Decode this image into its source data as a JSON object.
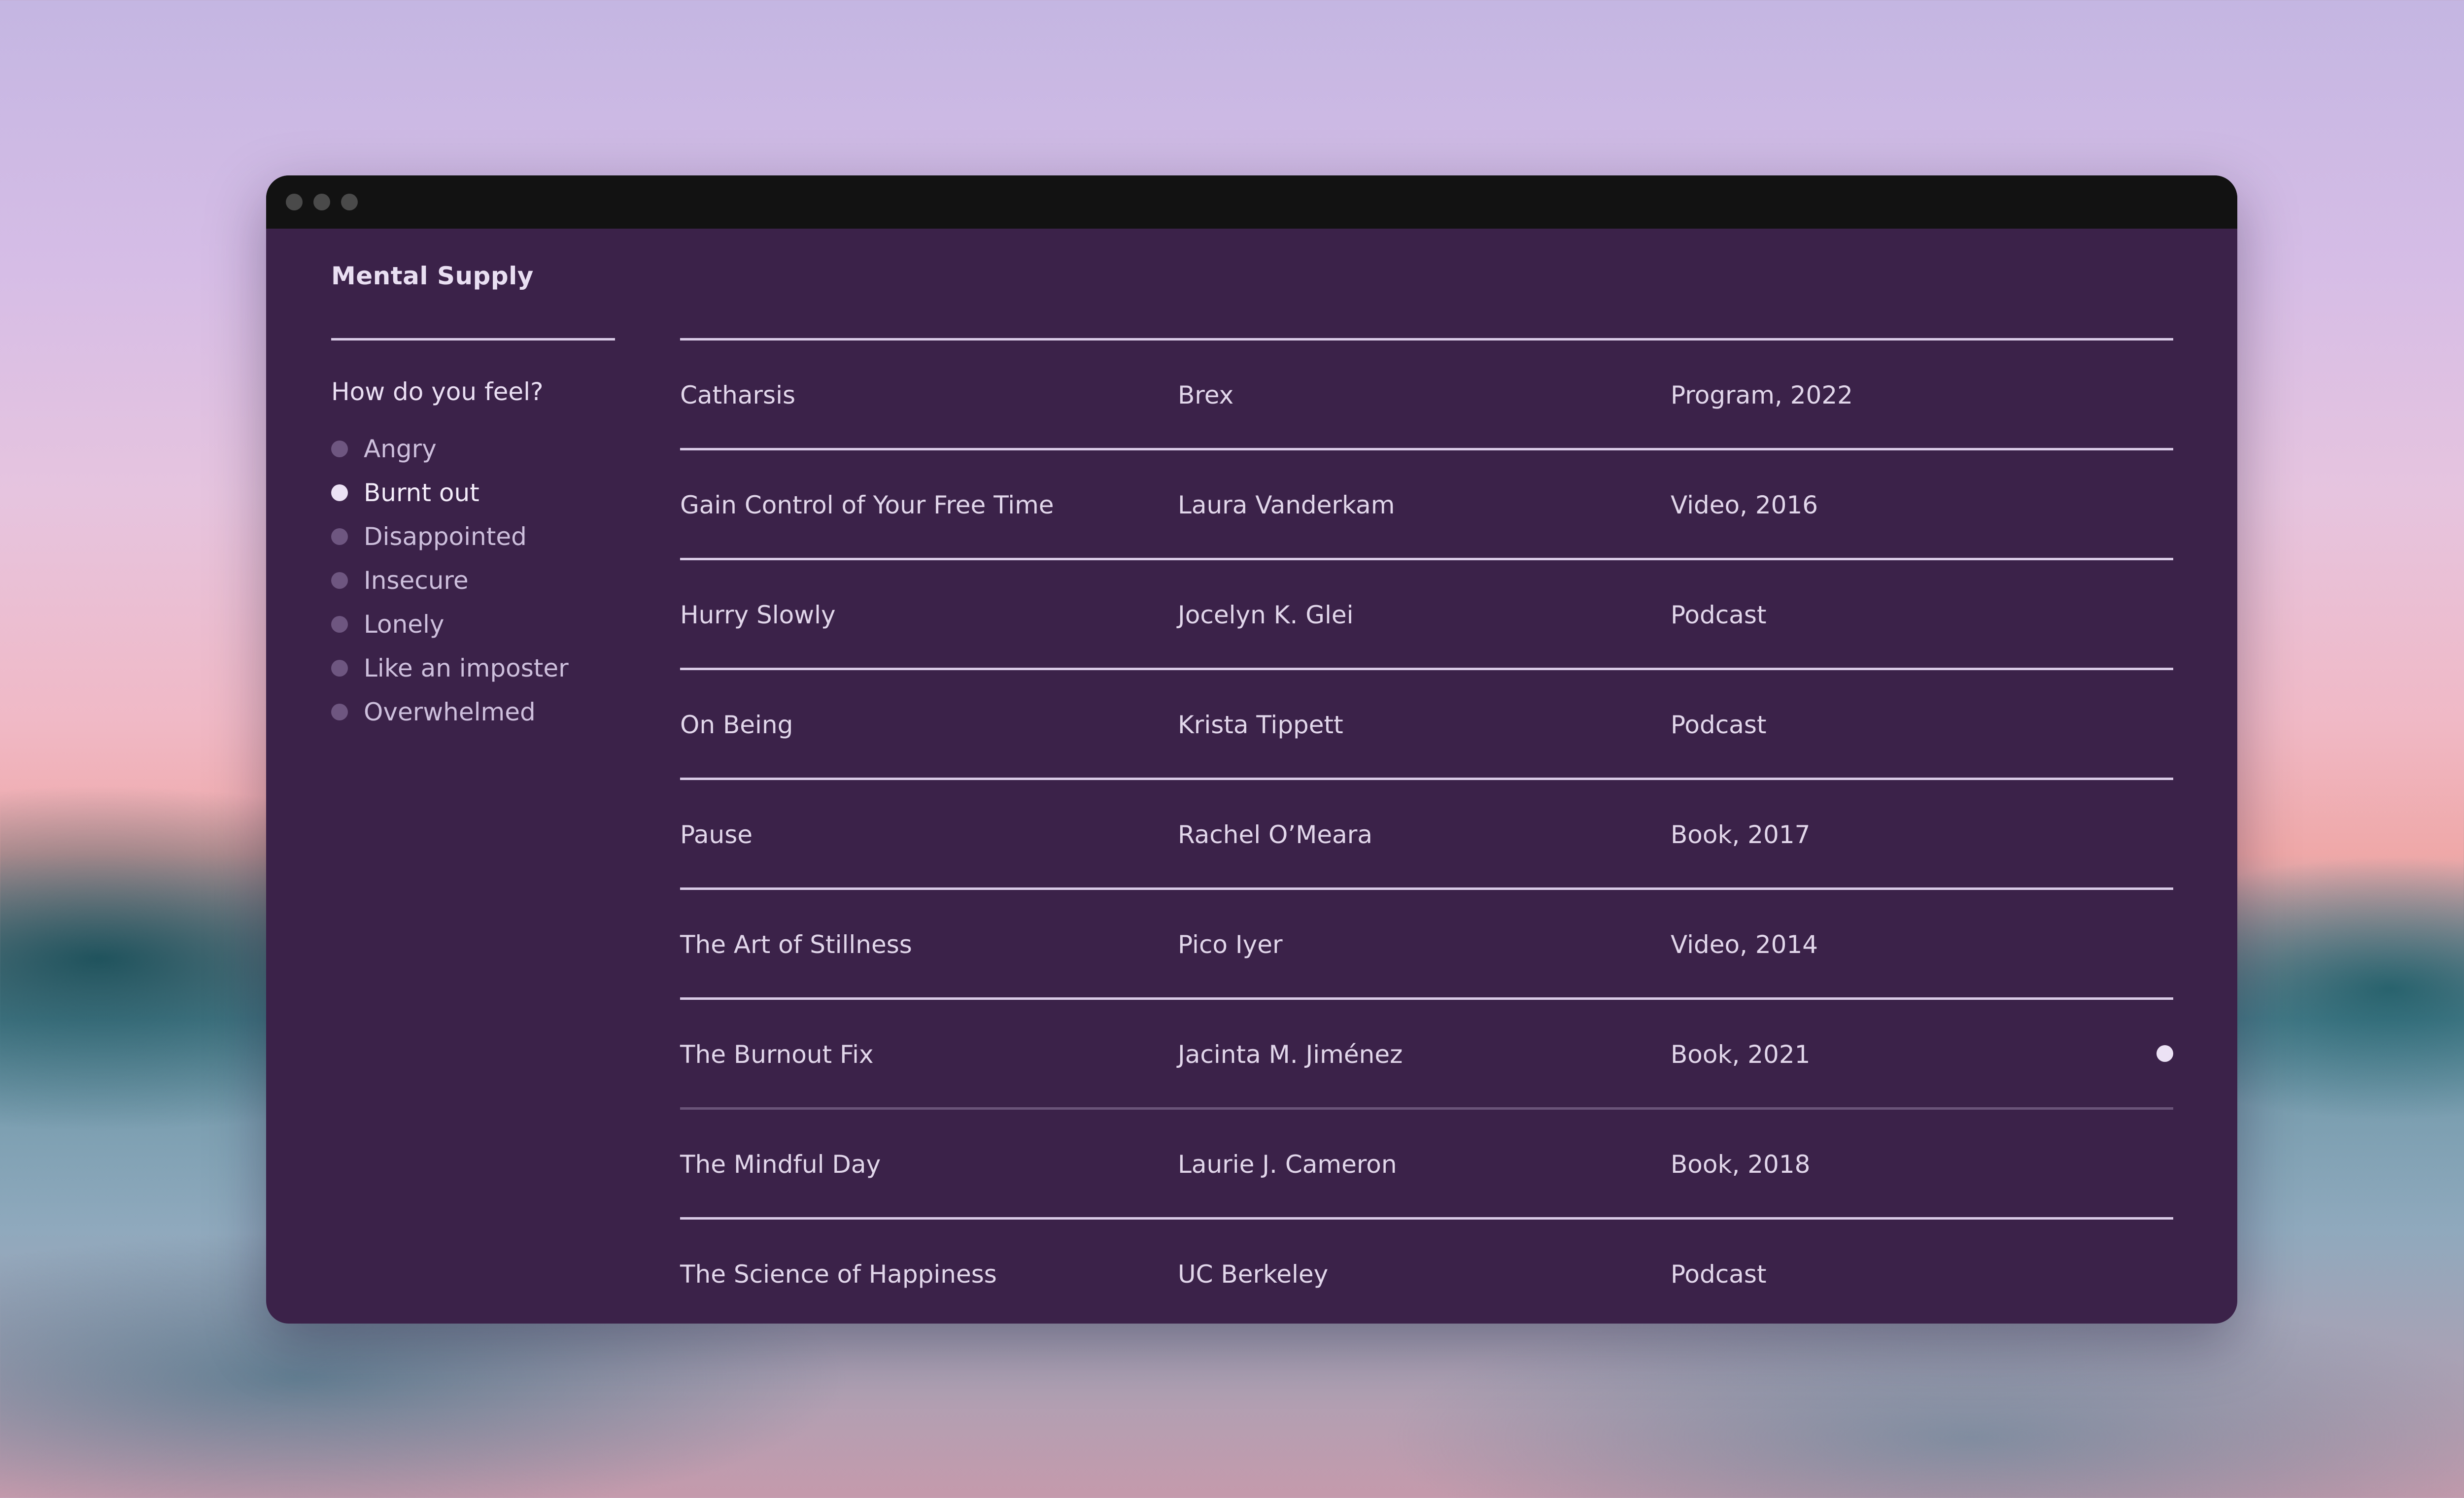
{
  "app": {
    "title": "Mental Supply"
  },
  "sidebar": {
    "heading": "How do you feel?",
    "selected_index": 1,
    "items": [
      {
        "label": "Angry"
      },
      {
        "label": "Burnt out"
      },
      {
        "label": "Disappointed"
      },
      {
        "label": "Insecure"
      },
      {
        "label": "Lonely"
      },
      {
        "label": "Like an imposter"
      },
      {
        "label": "Overwhelmed"
      }
    ]
  },
  "resources": {
    "active_index": 6,
    "rows": [
      {
        "title": "Catharsis",
        "author": "Brex",
        "type": "Program, 2022"
      },
      {
        "title": "Gain Control of Your Free Time",
        "author": "Laura Vanderkam",
        "type": "Video, 2016"
      },
      {
        "title": "Hurry Slowly",
        "author": "Jocelyn K. Glei",
        "type": "Podcast"
      },
      {
        "title": "On Being",
        "author": "Krista Tippett",
        "type": "Podcast"
      },
      {
        "title": "Pause",
        "author": "Rachel O’Meara",
        "type": "Book, 2017"
      },
      {
        "title": "The Art of Stillness",
        "author": "Pico Iyer",
        "type": "Video, 2014"
      },
      {
        "title": "The Burnout Fix",
        "author": "Jacinta M. Jiménez",
        "type": "Book, 2021"
      },
      {
        "title": "The Mindful Day",
        "author": "Laurie J. Cameron",
        "type": "Book, 2018"
      },
      {
        "title": "The Science of Happiness",
        "author": "UC Berkeley",
        "type": "Podcast"
      }
    ]
  },
  "colors": {
    "window_bg": "#3b2249",
    "titlebar_bg": "#121212",
    "text": "#e1d6ea",
    "accent": "#ece2f5"
  }
}
